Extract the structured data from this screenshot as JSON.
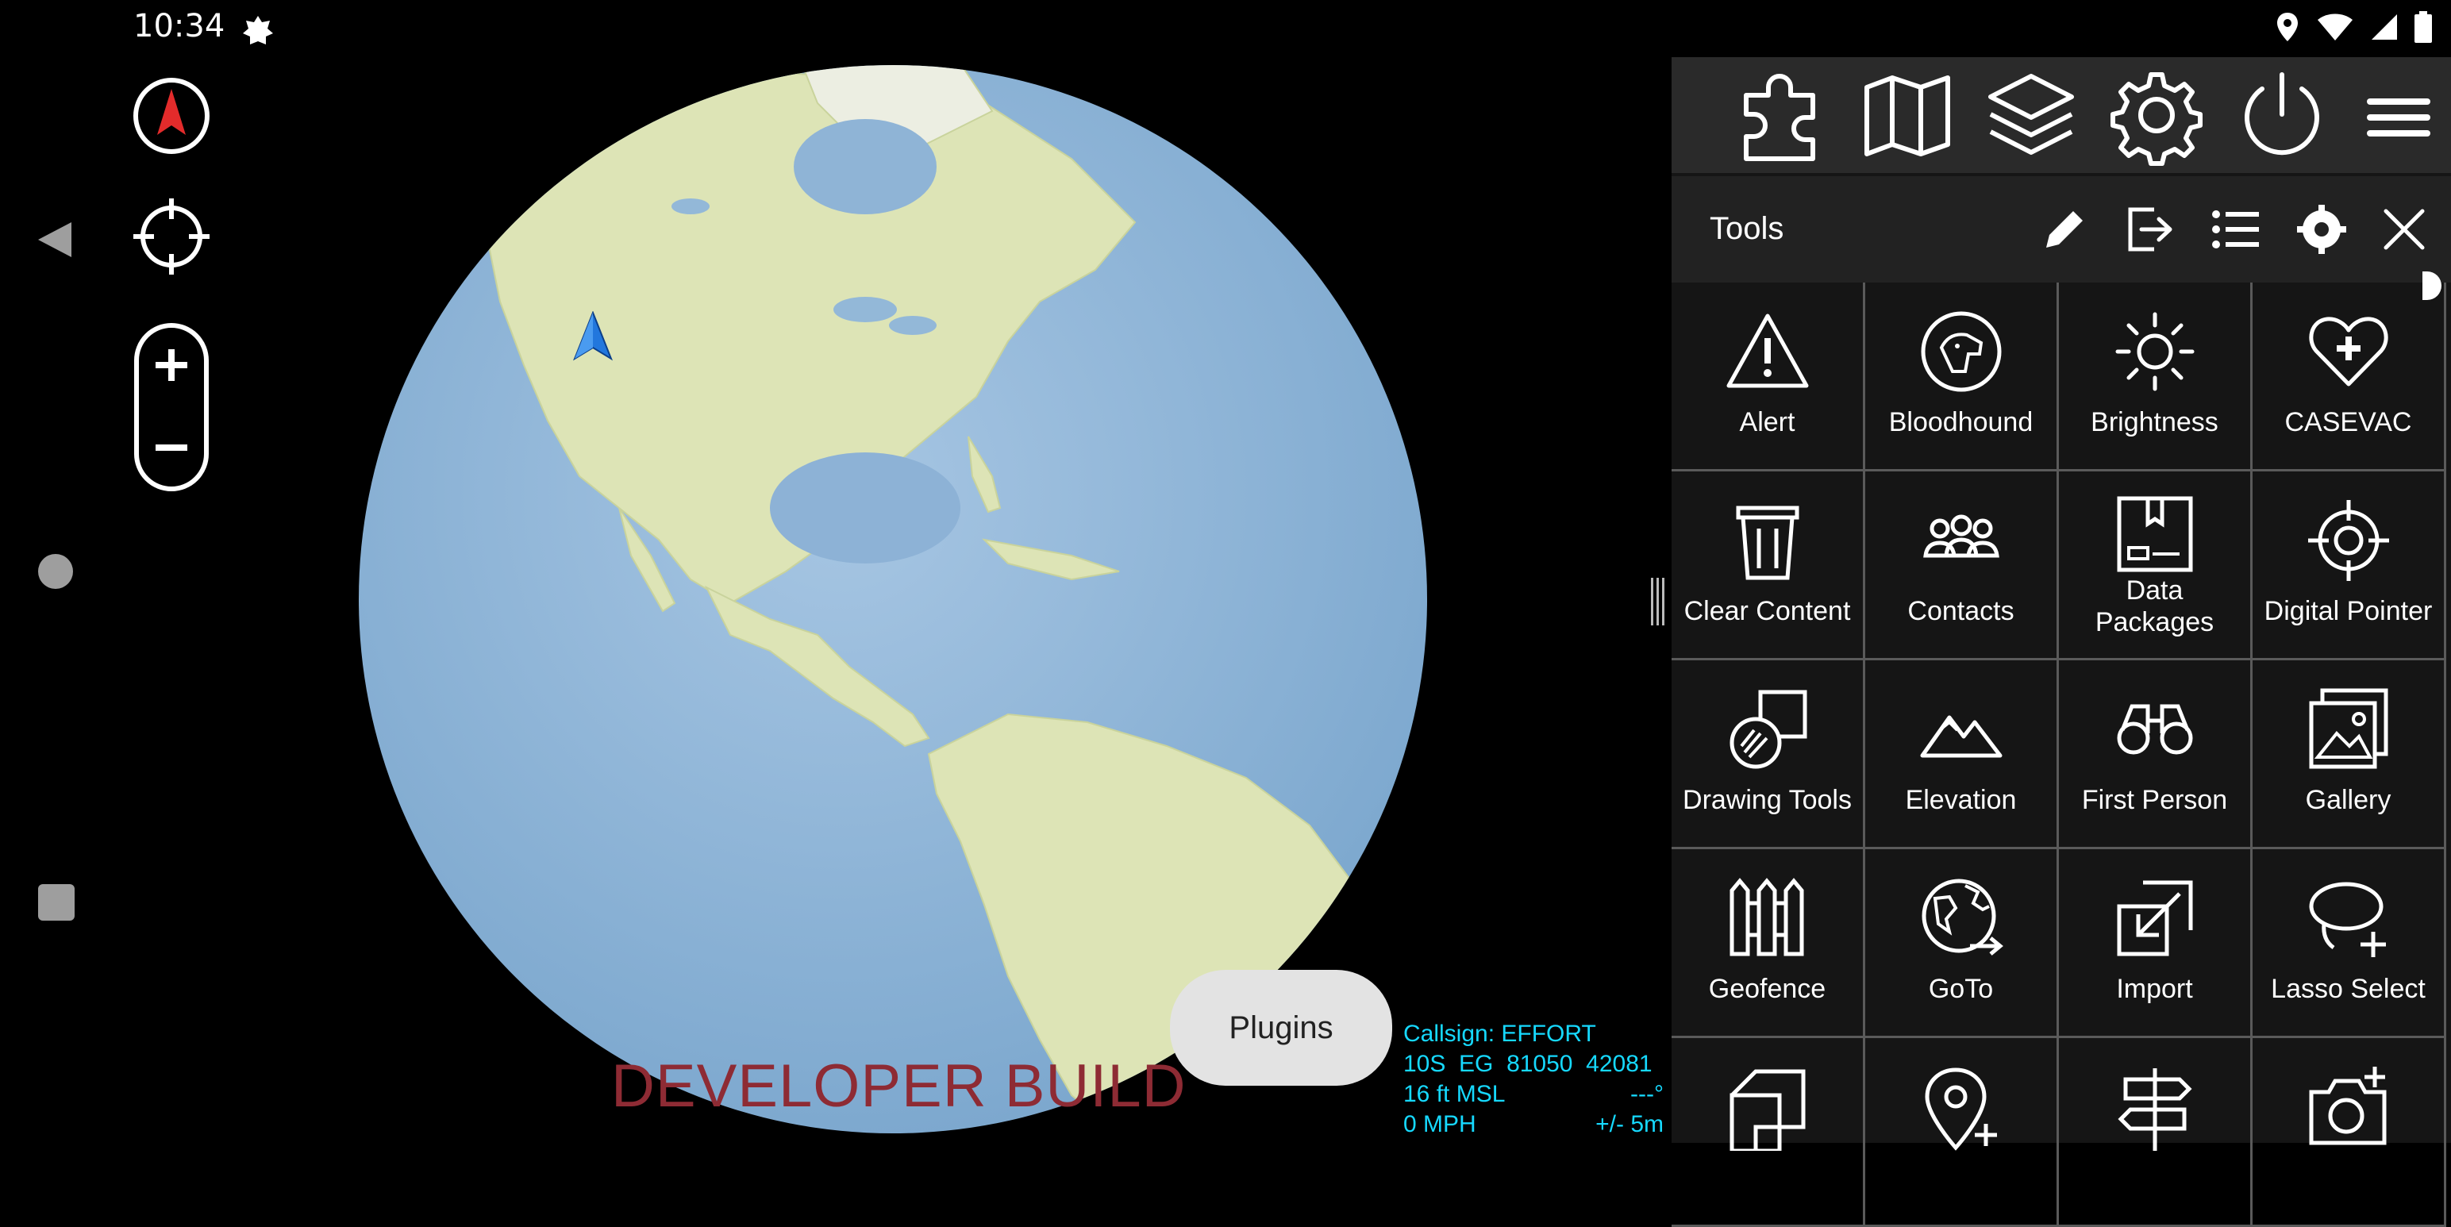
{
  "status_bar": {
    "time": "10:34"
  },
  "overlay": {
    "watermark": "DEVELOPER BUILD",
    "toast": "Plugins",
    "callsign": {
      "label": "Callsign: EFFORT",
      "grid": "10S  EG  81050  42081",
      "altitude": "16 ft MSL",
      "heading": "---°",
      "speed": "0 MPH",
      "accuracy": "+/- 5m"
    }
  },
  "panel": {
    "title": "Tools",
    "top_icons": [
      "puzzle-icon",
      "map-icon",
      "layers-icon",
      "gear-icon",
      "power-icon",
      "menu-icon"
    ],
    "bar_icons": [
      "pencil-icon",
      "export-icon",
      "list-icon",
      "gear-icon",
      "close-icon"
    ],
    "tools": [
      {
        "label": "Alert",
        "icon": "alert-icon"
      },
      {
        "label": "Bloodhound",
        "icon": "bloodhound-icon"
      },
      {
        "label": "Brightness",
        "icon": "brightness-icon"
      },
      {
        "label": "CASEVAC",
        "icon": "casevac-icon"
      },
      {
        "label": "Clear Content",
        "icon": "trash-icon"
      },
      {
        "label": "Contacts",
        "icon": "contacts-icon"
      },
      {
        "label": "Data\nPackages",
        "line1": "Data",
        "line2": "Packages",
        "icon": "data-packages-icon"
      },
      {
        "label": "Digital Pointer",
        "icon": "crosshair-icon"
      },
      {
        "label": "Drawing Tools",
        "icon": "drawing-tools-icon"
      },
      {
        "label": "Elevation",
        "icon": "mountains-icon"
      },
      {
        "label": "First Person",
        "icon": "binoculars-icon"
      },
      {
        "label": "Gallery",
        "icon": "gallery-icon"
      },
      {
        "label": "Geofence",
        "icon": "fence-icon"
      },
      {
        "label": "GoTo",
        "icon": "globe-arrow-icon"
      },
      {
        "label": "Import",
        "icon": "import-icon"
      },
      {
        "label": "Lasso Select",
        "icon": "lasso-icon"
      },
      {
        "label": "",
        "icon": "shapes-icon"
      },
      {
        "label": "",
        "icon": "map-pin-plus-icon"
      },
      {
        "label": "",
        "icon": "signpost-icon"
      },
      {
        "label": "",
        "icon": "camera-plus-icon"
      }
    ]
  },
  "colors": {
    "watermark": "#8e2b34",
    "callsign_text": "#16d9ff",
    "ocean": "#8fb6d8",
    "land": "#dfe6b9",
    "compass": "#e32b2b",
    "self_marker": "#2277dd"
  }
}
